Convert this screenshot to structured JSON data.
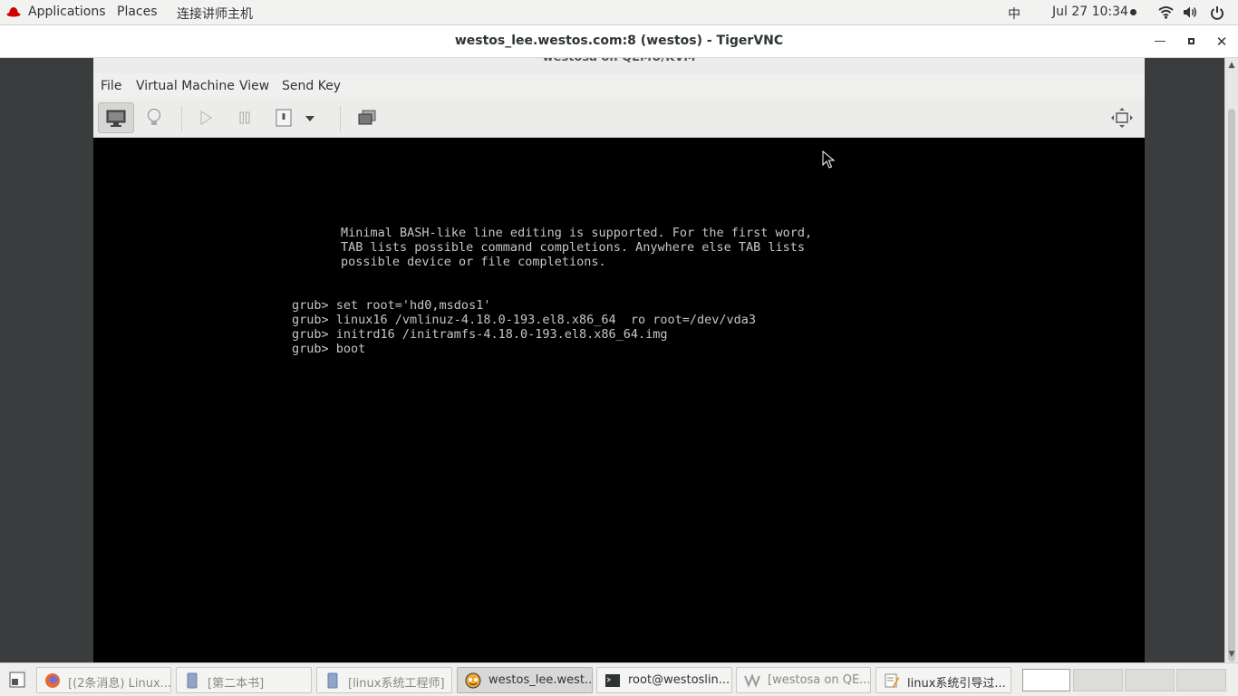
{
  "topbar": {
    "applications": "Applications",
    "places": "Places",
    "custom_menu": "连接讲师主机",
    "input_method": "中",
    "datetime": "Jul 27  10:34"
  },
  "vnc": {
    "window_title": "westos_lee.westos.com:8 (westos) - TigerVNC"
  },
  "vm": {
    "partial_title": "westosa on QEMU/KVM",
    "menu": [
      "File",
      "Virtual Machine",
      "View",
      "Send Key"
    ],
    "console_lines": [
      "Minimal BASH-like line editing is supported. For the first word,",
      "TAB lists possible command completions. Anywhere else TAB lists",
      "possible device or file completions.",
      "",
      "",
      "grub> set root='hd0,msdos1'",
      "grub> linux16 /vmlinuz-4.18.0-193.el8.x86_64  ro root=/dev/vda3",
      "grub> initrd16 /initramfs-4.18.0-193.el8.x86_64.img",
      "grub> boot"
    ]
  },
  "taskbar": {
    "tasks": [
      {
        "label": "[(2条消息) Linux...",
        "icon": "firefox-icon"
      },
      {
        "label": "[第二本书]",
        "icon": "document-icon"
      },
      {
        "label": "[linux系统工程师]",
        "icon": "document-icon"
      },
      {
        "label": "westos_lee.west...",
        "icon": "tigervnc-icon"
      },
      {
        "label": "root@westoslin...",
        "icon": "terminal-icon"
      },
      {
        "label": "[westosa on QE...",
        "icon": "virt-manager-icon"
      },
      {
        "label": "linux系统引导过...",
        "icon": "text-editor-icon"
      }
    ],
    "workspaces": 4
  },
  "colors": {
    "redhat": "#cc0000",
    "console_bg": "#000000",
    "console_text": "#c6c6c6"
  }
}
